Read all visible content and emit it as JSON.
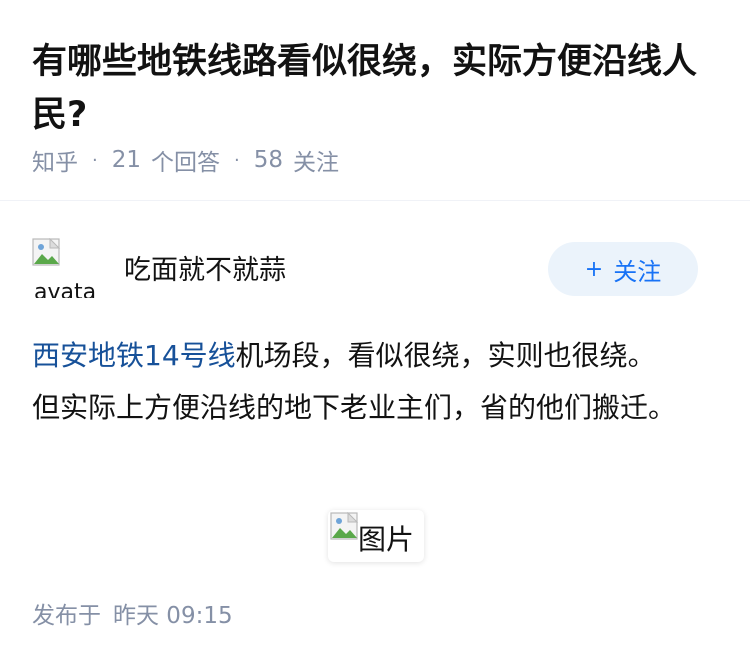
{
  "question": {
    "title": "有哪些地铁线路看似很绕，实际方便沿线人民?",
    "source": "知乎",
    "answers_count": "21",
    "answers_label": "个回答",
    "followers_count": "58",
    "followers_label": "关注"
  },
  "author": {
    "avatar_alt": "avatar",
    "name": "吃面就不就蒜",
    "follow_label": "关注",
    "follow_icon": "plus-icon"
  },
  "answer": {
    "link_text": "西安地铁14号线",
    "line1_rest": "机场段，看似很绕，实则也很绕。",
    "line2": "但实际上方便沿线的地下老业主们，省的他们搬迁。",
    "image_alt": "图片"
  },
  "footer": {
    "published_label": "发布于",
    "published_time": "昨天 09:15"
  },
  "colors": {
    "link": "#175199",
    "meta": "#8590a6",
    "follow_bg": "#ebf3fb",
    "follow_text": "#1772f6"
  }
}
